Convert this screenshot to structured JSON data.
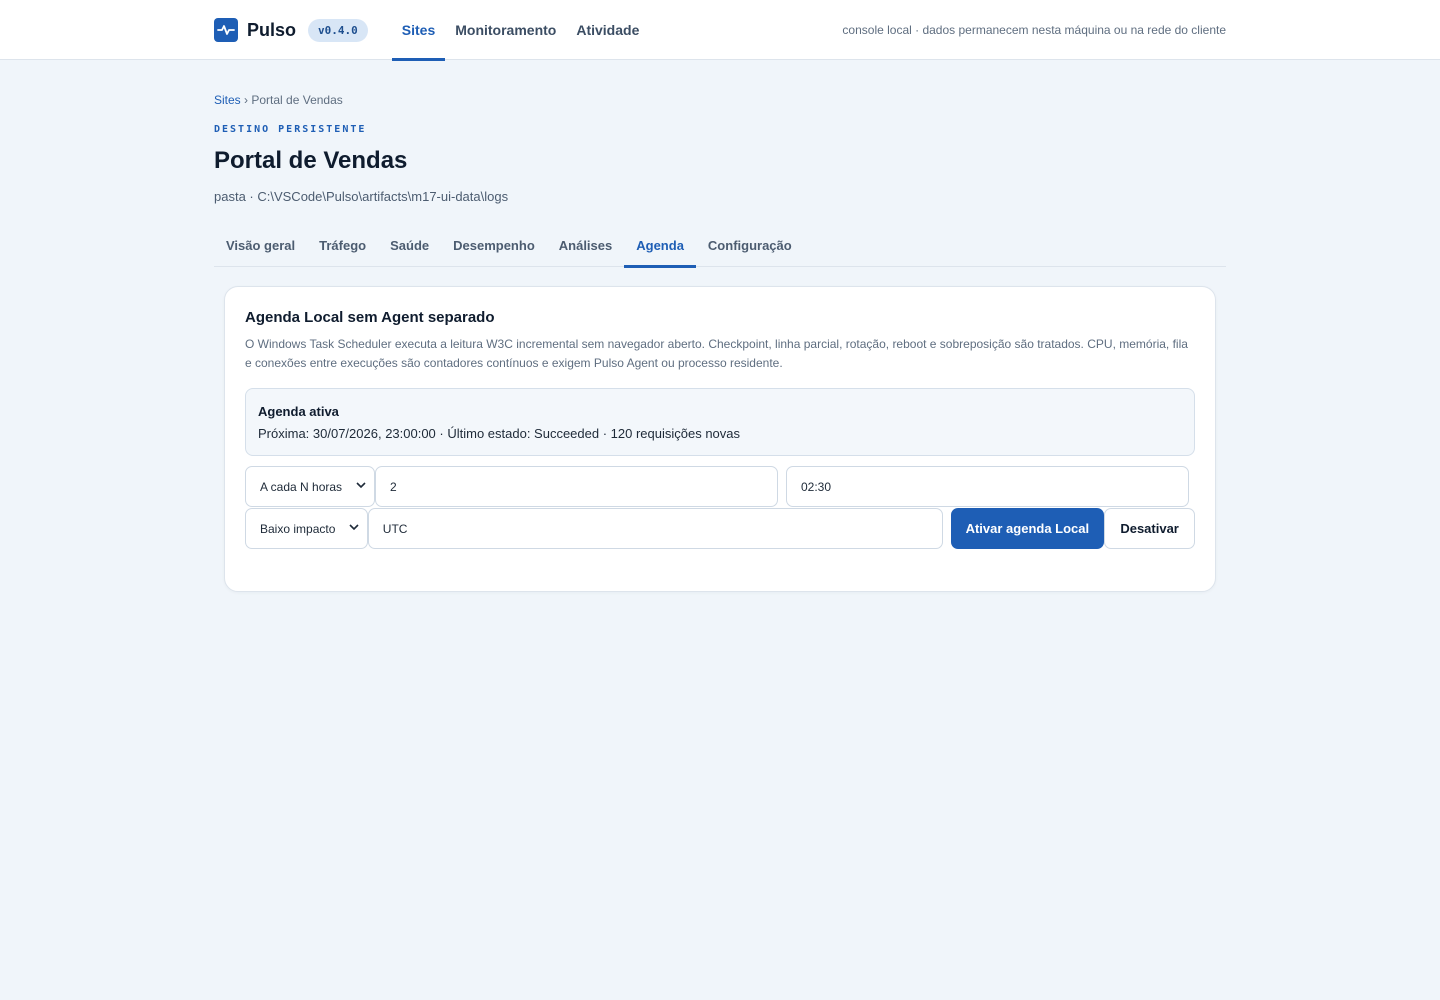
{
  "app": {
    "brand": "Pulso",
    "version": "v0.4.0",
    "nav": [
      {
        "label": "Sites",
        "active": true
      },
      {
        "label": "Monitoramento",
        "active": false
      },
      {
        "label": "Atividade",
        "active": false
      }
    ],
    "note": "console local · dados permanecem nesta máquina ou na rede do cliente"
  },
  "breadcrumb": {
    "root": "Sites",
    "separator": "›",
    "current": "Portal de Vendas"
  },
  "page": {
    "eyebrow": "DESTINO PERSISTENTE",
    "title": "Portal de Vendas",
    "path": "pasta · C:\\VSCode\\Pulso\\artifacts\\m17-ui-data\\logs"
  },
  "tabs": [
    {
      "label": "Visão geral",
      "active": false
    },
    {
      "label": "Tráfego",
      "active": false
    },
    {
      "label": "Saúde",
      "active": false
    },
    {
      "label": "Desempenho",
      "active": false
    },
    {
      "label": "Análises",
      "active": false
    },
    {
      "label": "Agenda",
      "active": true
    },
    {
      "label": "Configuração",
      "active": false
    }
  ],
  "agenda": {
    "title": "Agenda Local sem Agent separado",
    "description": "O Windows Task Scheduler executa a leitura W3C incremental sem navegador aberto. Checkpoint, linha parcial, rotação, reboot e sobreposição são tratados. CPU, memória, fila e conexões entre execuções são contadores contínuos e exigem Pulso Agent ou processo residente.",
    "status_title": "Agenda ativa",
    "status_detail": "Próxima: 30/07/2026, 23:00:00 · Último estado: Succeeded · 120 requisições novas",
    "frequency": "A cada N horas",
    "interval": "2",
    "time": "02:30",
    "impact": "Baixo impacto",
    "timezone": "UTC",
    "activate_label": "Ativar agenda Local",
    "deactivate_label": "Desativar"
  },
  "colors": {
    "accent": "#1e5eb5",
    "background": "#f0f5fa"
  }
}
